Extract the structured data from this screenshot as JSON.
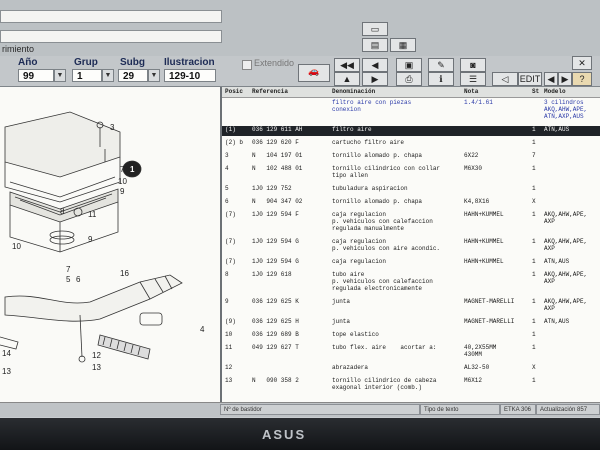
{
  "header": {
    "field1_label": "",
    "field2_label": "rimiento",
    "ref_label": "Referencia",
    "year_label": "Año",
    "group_label": "Grup",
    "subgroup_label": "Subg",
    "illustration_label": "Ilustracion",
    "year_value": "99",
    "group_value": "1",
    "subgroup_value": "29",
    "illustration_value": "129-10",
    "check_label": "Extendido"
  },
  "toolbar": {
    "edit_label": "EDIT",
    "help_label": "?"
  },
  "table": {
    "headers": {
      "pos": "Posic",
      "ref": "Referencia",
      "desc": "Denominación",
      "note": "Nota",
      "qty": "St",
      "model": "Modelo"
    },
    "rows": [
      {
        "pos": "",
        "ref": "",
        "desc": "filtro aire con piezas\nconexion",
        "note": "1.4/1.61",
        "qty": "",
        "model": "3 cilindros\nAKQ,AHW,APE,\nATN,AXP,AUS"
      },
      {
        "pos": "(1)",
        "ref": "036 129 611 AH",
        "desc": "filtro aire",
        "note": "",
        "qty": "1",
        "model": "ATN,AUS"
      },
      {
        "pos": "(2) b",
        "ref": "036 129 620 F",
        "desc": "cartucho filtro aire",
        "note": "",
        "qty": "1",
        "model": ""
      },
      {
        "pos": "3",
        "ref": "N   104 197 01",
        "desc": "tornillo alomado p. chapa",
        "note": "6X22",
        "qty": "7",
        "model": ""
      },
      {
        "pos": "4",
        "ref": "N   102 488 01",
        "desc": "tornillo cilindrico con collar\ntipo allen",
        "note": "M6X30",
        "qty": "1",
        "model": ""
      },
      {
        "pos": "5",
        "ref": "1J0 129 752",
        "desc": "tubuladura aspiracion",
        "note": "",
        "qty": "1",
        "model": ""
      },
      {
        "pos": "6",
        "ref": "N   904 347 02",
        "desc": "tornillo alomado p. chapa",
        "note": "K4,8X16",
        "qty": "X",
        "model": ""
      },
      {
        "pos": "(7)",
        "ref": "1J0 129 594 F",
        "desc": "caja regulacion\np. vehiculos con calefaccion\nregulada manualmente",
        "note": "HAHN+KUMMEL",
        "qty": "1",
        "model": "AKQ,AHW,APE,\nAXP"
      },
      {
        "pos": "(7)",
        "ref": "1J0 129 594 G",
        "desc": "caja regulacion\np. vehiculos con aire acondic.",
        "note": "HAHN+KUMMEL",
        "qty": "1",
        "model": "AKQ,AHW,APE,\nAXP"
      },
      {
        "pos": "(7)",
        "ref": "1J0 129 594 G",
        "desc": "caja regulacion",
        "note": "HAHN+KUMMEL",
        "qty": "1",
        "model": "ATN,AUS"
      },
      {
        "pos": "8",
        "ref": "1J0 129 618",
        "desc": "tubo aire\np. vehiculos con calefaccion\nregulada electronicamente",
        "note": "",
        "qty": "1",
        "model": "AKQ,AHW,APE,\nAXP"
      },
      {
        "pos": "9",
        "ref": "036 129 625 K",
        "desc": "junta",
        "note": "MAGNET-MARELLI",
        "qty": "1",
        "model": "AKQ,AHW,APE,\nAXP"
      },
      {
        "pos": "(9)",
        "ref": "036 129 625 H",
        "desc": "junta",
        "note": "MAGNET-MARELLI",
        "qty": "1",
        "model": "ATN,AUS"
      },
      {
        "pos": "10",
        "ref": "036 129 689 B",
        "desc": "tope elastico",
        "note": "",
        "qty": "1",
        "model": ""
      },
      {
        "pos": "11",
        "ref": "049 129 627 T",
        "desc": "tubo flex. aire    acortar a:",
        "note": "40,2X55MM\n430MM",
        "qty": "1",
        "model": ""
      },
      {
        "pos": "12",
        "ref": "",
        "desc": "abrazadera",
        "note": "AL32-50",
        "qty": "X",
        "model": ""
      },
      {
        "pos": "13",
        "ref": "N   090 358 2",
        "desc": "tornillo cilindrico de cabeza\nexagonal interior (comb.)",
        "note": "M6X12",
        "qty": "1",
        "model": ""
      }
    ]
  },
  "diagram": {
    "callouts": [
      "3",
      "1",
      "7",
      "10",
      "9",
      "11",
      "8",
      "9",
      "10",
      "7",
      "5",
      "6",
      "16",
      "4",
      "12",
      "13",
      "14",
      "13"
    ]
  },
  "status": {
    "frame_label": "Nº de bastidor",
    "text_type_label": "Tipo de texto",
    "version_label": "ETKA 306",
    "update_label": "Actualización 857"
  },
  "monitor": {
    "brand": "ASUS"
  }
}
